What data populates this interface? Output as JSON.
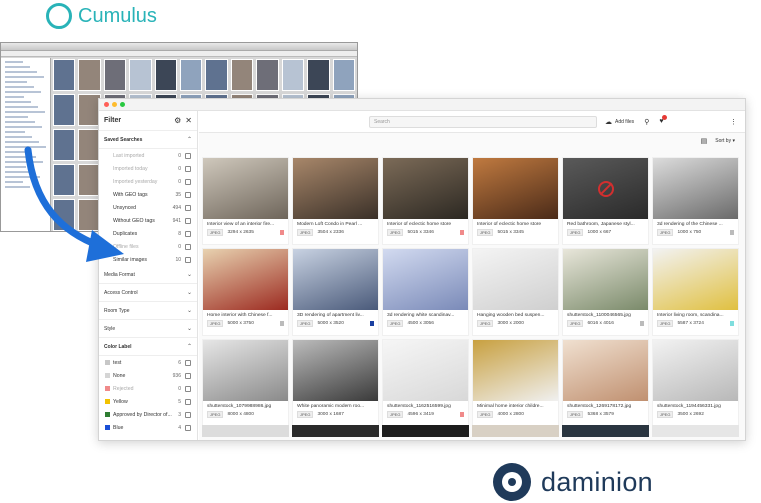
{
  "logos": {
    "cumulus": "Cumulus",
    "daminion": "daminion"
  },
  "colors": {
    "cumulus": "#29b3b8",
    "daminion": "#1f3a5a",
    "arrow": "#1e6fd9"
  },
  "filter": {
    "title": "Filter",
    "saved_searches": {
      "title": "Saved Searches",
      "items": [
        {
          "label": "Last imported",
          "count": "0",
          "dim": true
        },
        {
          "label": "Imported today",
          "count": "0",
          "dim": true
        },
        {
          "label": "Imported yesterday",
          "count": "0",
          "dim": true
        },
        {
          "label": "With GEO tags",
          "count": "35",
          "dim": false
        },
        {
          "label": "Unsynced",
          "count": "494",
          "dim": false
        },
        {
          "label": "Without GEO tags",
          "count": "941",
          "dim": false
        },
        {
          "label": "Duplicates",
          "count": "8",
          "dim": false
        },
        {
          "label": "Offline files",
          "count": "0",
          "dim": true
        },
        {
          "label": "Similar images",
          "count": "10",
          "dim": false
        }
      ]
    },
    "sections": [
      "Media Format",
      "Access Control",
      "Room Type",
      "Style"
    ],
    "color_label": {
      "title": "Color Label",
      "items": [
        {
          "label": "test",
          "count": "6",
          "color": "#c7c7c7",
          "dim": false
        },
        {
          "label": "None",
          "count": "936",
          "color": "#d5d5d5",
          "dim": false
        },
        {
          "label": "Rejected",
          "count": "0",
          "color": "#f08a8a",
          "dim": true
        },
        {
          "label": "Yellow",
          "count": "5",
          "color": "#f2c200",
          "dim": false
        },
        {
          "label": "Approved by Director of...",
          "count": "3",
          "color": "#2e7d32",
          "dim": false
        },
        {
          "label": "Blue",
          "count": "4",
          "color": "#1a4fd6",
          "dim": false
        }
      ]
    }
  },
  "toolbar": {
    "search_placeholder": "Search",
    "add_files": "Add files",
    "sort": "Sort by"
  },
  "grid": [
    {
      "caption": "Interior view of an interior fire...",
      "format": "JPEG",
      "dims": "3294 x 2635",
      "flag": "#f08a8a",
      "colors": [
        "#6e655a",
        "#cfc8bc"
      ]
    },
    {
      "caption": "Modern Loft Condo in Pearl ...",
      "format": "JPEG",
      "dims": "3504 x 2336",
      "flag": "",
      "colors": [
        "#3a3028",
        "#a8876a"
      ]
    },
    {
      "caption": "Interior of eclectic home store",
      "format": "JPEG",
      "dims": "5015 x 3346",
      "flag": "#f08a8a",
      "colors": [
        "#2c2822",
        "#7c6b58"
      ]
    },
    {
      "caption": "Interior of eclectic home store",
      "format": "JPEG",
      "dims": "5015 x 3345",
      "flag": "",
      "colors": [
        "#4a2a18",
        "#c07a40"
      ]
    },
    {
      "caption": "Red bathroom, Japanese styl...",
      "format": "JPEG",
      "dims": "1000 x 667",
      "flag": "",
      "colors": [
        "#2a2a2a",
        "#5a5a5a"
      ],
      "reject": true
    },
    {
      "caption": "3d rendering of the Chinese ...",
      "format": "JPEG",
      "dims": "1000 x 750",
      "flag": "#bbbbbb",
      "colors": [
        "#6a6a6a",
        "#dcdcdc"
      ]
    },
    {
      "caption": "Home interior with Chinese f...",
      "format": "JPEG",
      "dims": "5000 x 3750",
      "flag": "#bbbbbb",
      "colors": [
        "#9c2a20",
        "#e8d2b0"
      ]
    },
    {
      "caption": "3D rendering of apartment liv...",
      "format": "JPEG",
      "dims": "5000 x 3520",
      "flag": "#1a3fa0",
      "colors": [
        "#4a5a7a",
        "#c8d2e2"
      ]
    },
    {
      "caption": "3d rendering white scandinav...",
      "format": "JPEG",
      "dims": "4500 x 3056",
      "flag": "",
      "colors": [
        "#7a8ab8",
        "#d2daf0"
      ]
    },
    {
      "caption": "Hanging wooden bed suspen...",
      "format": "JPEG",
      "dims": "3000 x 2000",
      "flag": "",
      "colors": [
        "#cfcfcf",
        "#f4f4f4"
      ]
    },
    {
      "caption": "shutterstock_1100046565.jpg",
      "format": "JPEG",
      "dims": "6016 x 4016",
      "flag": "#bbbbbb",
      "colors": [
        "#7a8a6a",
        "#e8e6da"
      ]
    },
    {
      "caption": "Interior living room, scandina...",
      "format": "JPEG",
      "dims": "5587 x 3724",
      "flag": "#7fdede",
      "colors": [
        "#e0c040",
        "#f2f2f2"
      ]
    },
    {
      "caption": "shutterstock_1079988986.jpg",
      "format": "JPEG",
      "dims": "8000 x 4800",
      "flag": "",
      "colors": [
        "#8a8a8a",
        "#e6e6e6"
      ]
    },
    {
      "caption": "White panoramic modern roo...",
      "format": "JPEG",
      "dims": "3000 x 1687",
      "flag": "",
      "colors": [
        "#3a3a3a",
        "#bcbcbc"
      ]
    },
    {
      "caption": "shutterstock_1162516599.jpg",
      "format": "JPEG",
      "dims": "4596 x 3419",
      "flag": "#f08a8a",
      "colors": [
        "#d8d8d8",
        "#f6f6f6"
      ]
    },
    {
      "caption": "Minimal home interior childre...",
      "format": "JPEG",
      "dims": "4000 x 2800",
      "flag": "",
      "colors": [
        "#f0f0f0",
        "#c8a040"
      ]
    },
    {
      "caption": "shutterstock_1269178172.jpg",
      "format": "JPEG",
      "dims": "5368 x 3579",
      "flag": "",
      "colors": [
        "#c09070",
        "#f0e0d0"
      ]
    },
    {
      "caption": "shutterstock_1194456331.jpg",
      "format": "JPEG",
      "dims": "3500 x 2692",
      "flag": "",
      "colors": [
        "#b8b8b8",
        "#f2f2f2"
      ]
    }
  ],
  "peek_colors": [
    "#dcdcdc",
    "#2a2a2a",
    "#1c1c1c",
    "#d8d0c4",
    "#2a3540",
    "#e6e6e6"
  ]
}
